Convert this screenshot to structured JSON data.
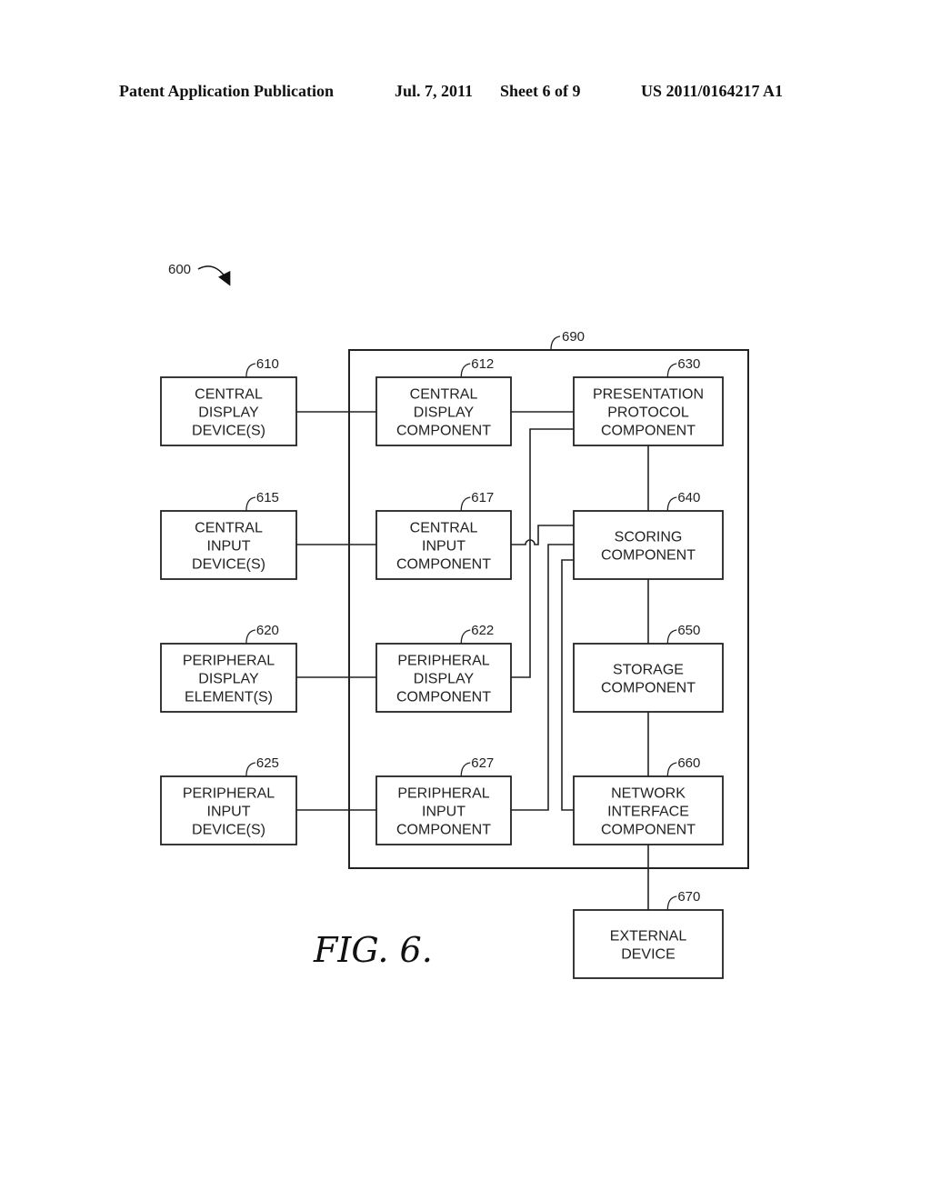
{
  "header": {
    "publication": "Patent Application Publication",
    "date": "Jul. 7, 2011",
    "sheet": "Sheet 6 of 9",
    "number": "US 2011/0164217 A1"
  },
  "figure": {
    "ref": "600",
    "caption": "FIG. 6.",
    "container": {
      "ref": "690"
    },
    "blocks": [
      {
        "id": "610",
        "lines": [
          "CENTRAL",
          "DISPLAY",
          "DEVICE(S)"
        ]
      },
      {
        "id": "615",
        "lines": [
          "CENTRAL",
          "INPUT",
          "DEVICE(S)"
        ]
      },
      {
        "id": "620",
        "lines": [
          "PERIPHERAL",
          "DISPLAY",
          "ELEMENT(S)"
        ]
      },
      {
        "id": "625",
        "lines": [
          "PERIPHERAL",
          "INPUT",
          "DEVICE(S)"
        ]
      },
      {
        "id": "612",
        "lines": [
          "CENTRAL",
          "DISPLAY",
          "COMPONENT"
        ]
      },
      {
        "id": "617",
        "lines": [
          "CENTRAL",
          "INPUT",
          "COMPONENT"
        ]
      },
      {
        "id": "622",
        "lines": [
          "PERIPHERAL",
          "DISPLAY",
          "COMPONENT"
        ]
      },
      {
        "id": "627",
        "lines": [
          "PERIPHERAL",
          "INPUT",
          "COMPONENT"
        ]
      },
      {
        "id": "630",
        "lines": [
          "PRESENTATION",
          "PROTOCOL",
          "COMPONENT"
        ]
      },
      {
        "id": "640",
        "lines": [
          "SCORING",
          "COMPONENT"
        ]
      },
      {
        "id": "650",
        "lines": [
          "STORAGE",
          "COMPONENT"
        ]
      },
      {
        "id": "660",
        "lines": [
          "NETWORK",
          "INTERFACE",
          "COMPONENT"
        ]
      },
      {
        "id": "670",
        "lines": [
          "EXTERNAL",
          "DEVICE"
        ]
      }
    ],
    "connections": [
      [
        "610",
        "612"
      ],
      [
        "615",
        "617"
      ],
      [
        "620",
        "622"
      ],
      [
        "625",
        "627"
      ],
      [
        "612",
        "630"
      ],
      [
        "622",
        "630"
      ],
      [
        "617",
        "640"
      ],
      [
        "627",
        "640"
      ],
      [
        "630",
        "640"
      ],
      [
        "640",
        "650"
      ],
      [
        "650",
        "660"
      ],
      [
        "660",
        "640"
      ],
      [
        "660",
        "670"
      ]
    ]
  }
}
